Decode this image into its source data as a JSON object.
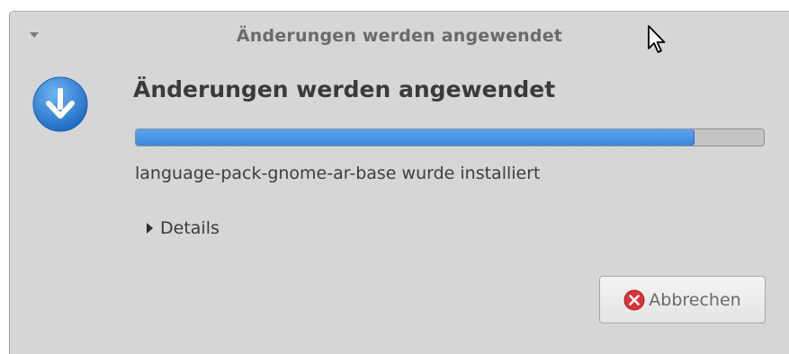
{
  "window": {
    "title": "Änderungen werden angewendet"
  },
  "main": {
    "heading": "Änderungen werden angewendet",
    "progress_fraction": 0.89,
    "status": "language-pack-gnome-ar-base wurde installiert"
  },
  "details": {
    "label": "Details",
    "expanded": false
  },
  "actions": {
    "cancel_label": "Abbrechen"
  },
  "icons": {
    "app": "download-arrow-icon",
    "cancel": "cancel-icon",
    "expander": "expander-arrow-icon",
    "window_menu": "window-menu-icon"
  },
  "colors": {
    "progress": "#3a86db",
    "app_icon": "#2f7fd3",
    "cancel_icon": "#d9343a"
  }
}
